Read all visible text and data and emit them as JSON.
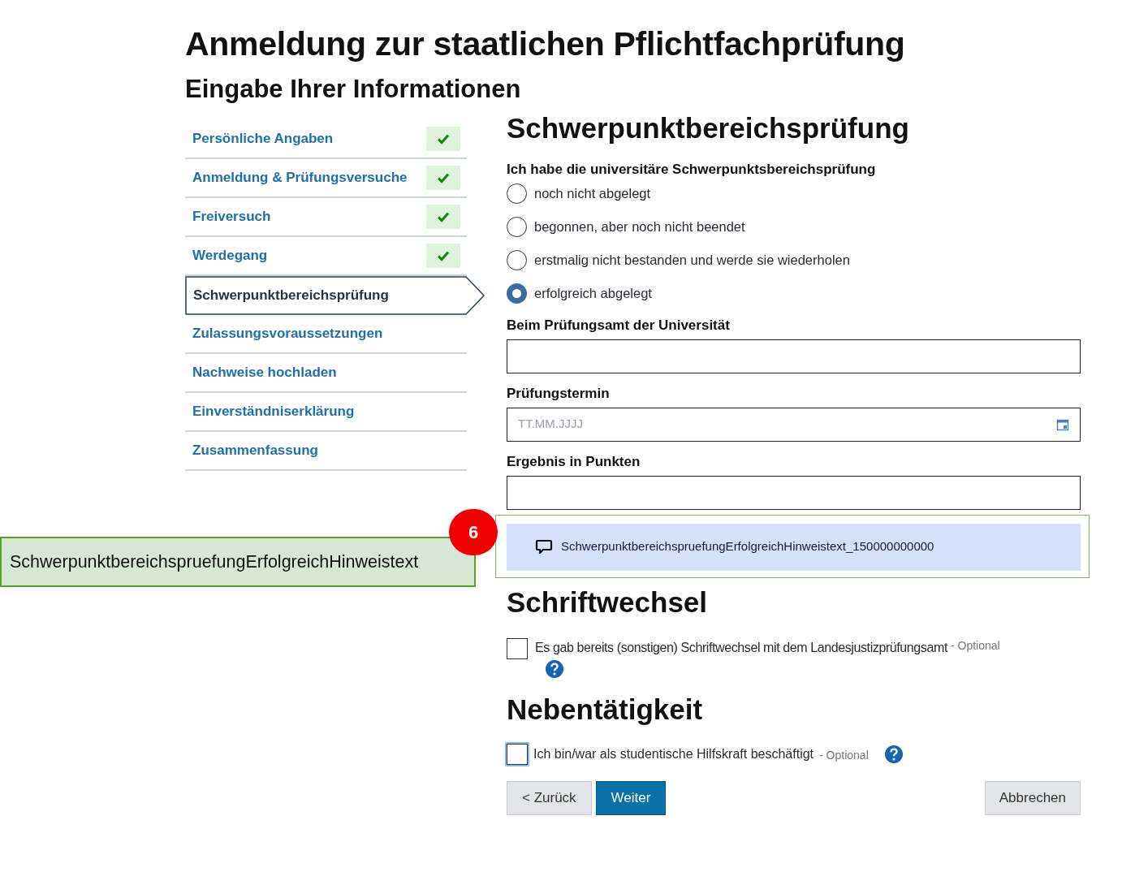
{
  "title": "Anmeldung zur staatlichen Pflichtfachprüfung",
  "subtitle": "Eingabe Ihrer Informationen",
  "sidebar": {
    "items": [
      {
        "label": "Persönliche Angaben",
        "done": true,
        "selected": false
      },
      {
        "label": "Anmeldung & Prüfungsversuche",
        "done": true,
        "selected": false
      },
      {
        "label": "Freiversuch",
        "done": true,
        "selected": false
      },
      {
        "label": "Werdegang",
        "done": true,
        "selected": false
      },
      {
        "label": "Schwerpunktbereichsprüfung",
        "done": false,
        "selected": true
      },
      {
        "label": "Zulassungsvoraussetzungen",
        "done": false,
        "selected": false
      },
      {
        "label": "Nachweise hochladen",
        "done": false,
        "selected": false
      },
      {
        "label": "Einverständniserklärung",
        "done": false,
        "selected": false
      },
      {
        "label": "Zusammenfassung",
        "done": false,
        "selected": false
      }
    ]
  },
  "section": {
    "heading": "Schwerpunktbereichsprüfung",
    "question": "Ich habe die universitäre Schwerpunktsbereichsprüfung",
    "options": [
      {
        "label": "noch nicht abgelegt",
        "selected": false
      },
      {
        "label": "begonnen, aber noch nicht beendet",
        "selected": false
      },
      {
        "label": "erstmalig nicht bestanden und werde sie wiederholen",
        "selected": false
      },
      {
        "label": "erfolgreich abgelegt",
        "selected": true
      }
    ],
    "fields": [
      {
        "label": "Beim Prüfungsamt der Universität",
        "kind": "text"
      },
      {
        "label": "Prüfungstermin",
        "kind": "date",
        "placeholder": "TT.MM.JJJJ"
      },
      {
        "label": "Ergebnis in Punkten",
        "kind": "text"
      }
    ],
    "hint": "SchwerpunktbereichspruefungErfolgreichHinweistext_150000000000"
  },
  "correspondence": {
    "heading": "Schriftwechsel",
    "label": "Es gab bereits (sonstigen) Schriftwechsel mit dem Landesjustizprüfungsamt",
    "optional": "- Optional",
    "checked": false
  },
  "side_job": {
    "heading": "Nebentätigkeit",
    "label": "Ich bin/war als studentische Hilfskraft beschäftigt",
    "optional": "- Optional",
    "checked": false,
    "focused": true
  },
  "buttons": {
    "back": "< Zurück",
    "next": "Weiter",
    "cancel": "Abbrechen"
  },
  "annotation": {
    "label": "SchwerpunktbereichspruefungErfolgreichHinweistext",
    "number": "6"
  }
}
